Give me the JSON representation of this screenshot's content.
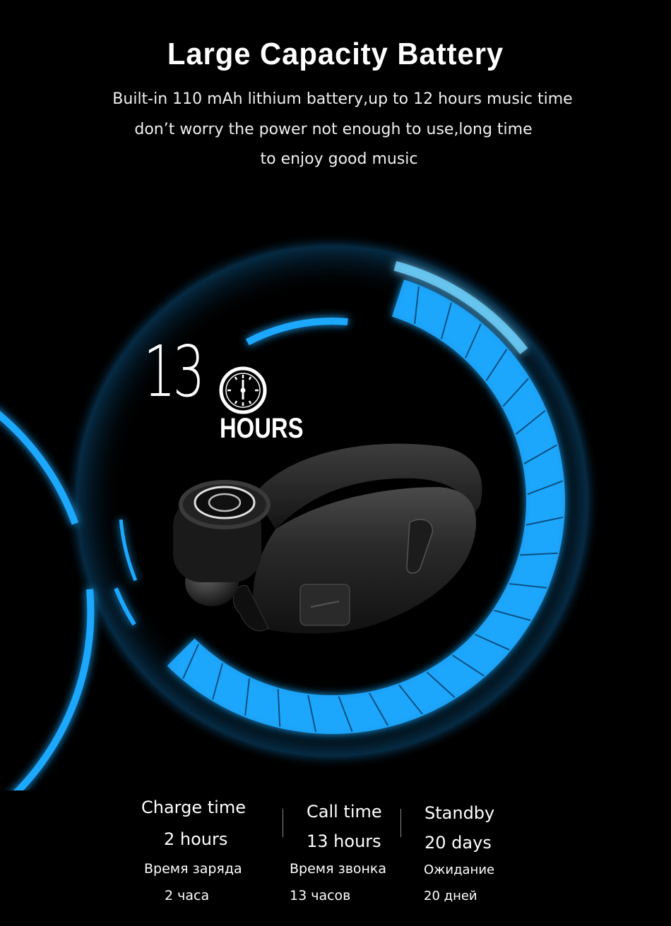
{
  "header": {
    "title": "Large Capacity Battery",
    "lines": [
      "Built-in 110 mAh lithium battery,up to 12 hours music time",
      "don’t worry the power not enough to use,long time",
      "to  enjoy good music"
    ]
  },
  "hero": {
    "number": "13",
    "unit": "HOURS",
    "ring_color": "#1aa8ff",
    "ring_glow": "#6fd3ff",
    "icons": [
      "clock-icon",
      "bluetooth-earpiece-image"
    ]
  },
  "stats": [
    {
      "label": "Charge time",
      "value": "2 hours",
      "label_ru": "Время заряда",
      "value_ru": "2 часа"
    },
    {
      "label": "Call time",
      "value": "13 hours",
      "label_ru": "Время звонка",
      "value_ru": "13 часов"
    },
    {
      "label": "Standby",
      "value": "20 days",
      "label_ru": "Ожидание",
      "value_ru": "20 дней"
    }
  ]
}
